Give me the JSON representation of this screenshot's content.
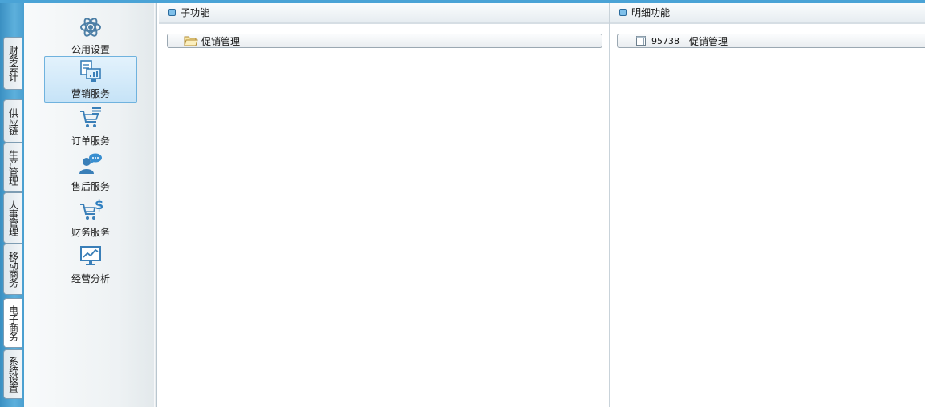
{
  "vertical_tabs": [
    {
      "label": "财务会计",
      "active": false
    },
    {
      "label": "供应链",
      "active": false
    },
    {
      "label": "生产管理",
      "active": false
    },
    {
      "label": "人事管理",
      "active": false
    },
    {
      "label": "移动商务",
      "active": false
    },
    {
      "label": "电子商务",
      "active": true
    },
    {
      "label": "系统设置",
      "active": false
    }
  ],
  "categories": [
    {
      "label": "公用设置",
      "icon": "atom-icon",
      "selected": false
    },
    {
      "label": "营销服务",
      "icon": "document-chart-icon",
      "selected": true
    },
    {
      "label": "订单服务",
      "icon": "shopping-cart-list-icon",
      "selected": false
    },
    {
      "label": "售后服务",
      "icon": "user-chat-icon",
      "selected": false
    },
    {
      "label": "财务服务",
      "icon": "cart-dollar-icon",
      "selected": false
    },
    {
      "label": "经营分析",
      "icon": "monitor-chart-icon",
      "selected": false
    }
  ],
  "sub_functions": {
    "title": "子功能",
    "items": [
      {
        "label": "促销管理",
        "icon": "folder-icon"
      }
    ]
  },
  "detail_functions": {
    "title": "明细功能",
    "items": [
      {
        "code": "95738",
        "label": "促销管理",
        "icon": "page-icon"
      }
    ]
  },
  "colors": {
    "frame": "#4aa3d6",
    "accent": "#3a8fd0",
    "selected_bg": "#c6e3f7"
  }
}
